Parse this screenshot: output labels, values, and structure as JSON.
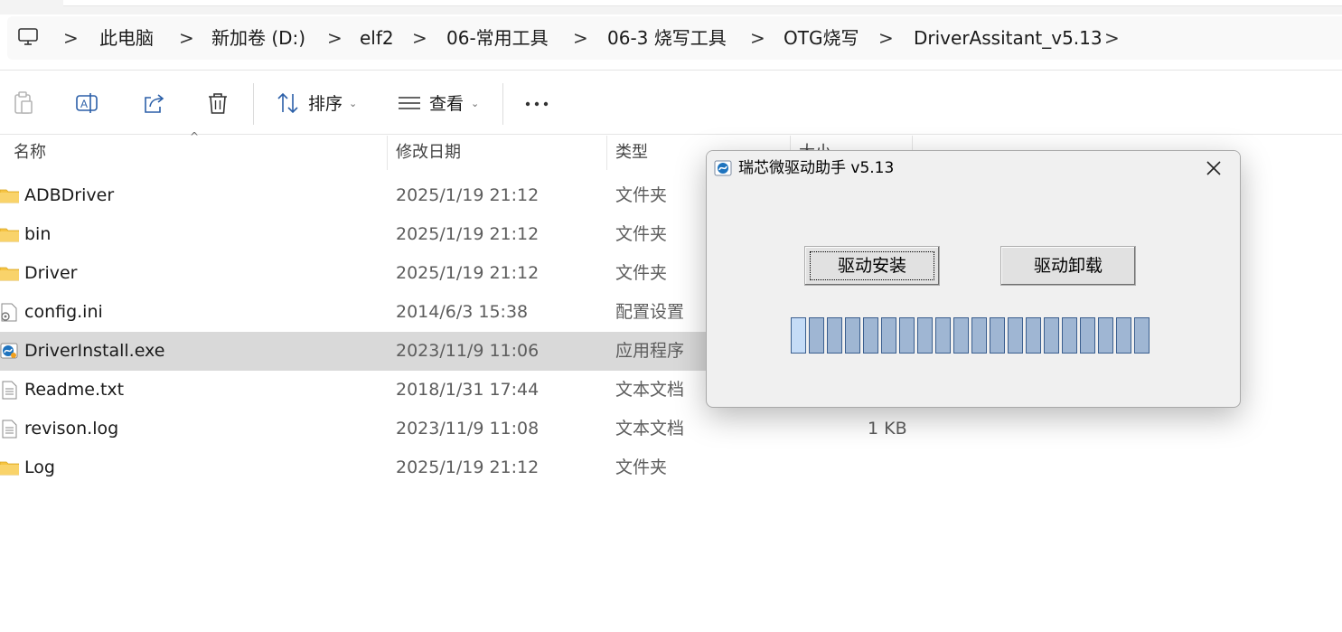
{
  "address_bar": {
    "segments": [
      "此电脑",
      "新加卷 (D:)",
      "elf2",
      "06-常用工具",
      "06-3 烧写工具",
      "OTG烧写",
      "DriverAssitant_v5.13"
    ],
    "separator": ">"
  },
  "toolbar": {
    "sort_label": "排序",
    "view_label": "查看"
  },
  "columns": {
    "name": "名称",
    "date": "修改日期",
    "type": "类型",
    "size": "大小"
  },
  "files": [
    {
      "name": "ADBDriver",
      "date": "2025/1/19 21:12",
      "type": "文件夹",
      "size": "",
      "icon": "folder-icon"
    },
    {
      "name": "bin",
      "date": "2025/1/19 21:12",
      "type": "文件夹",
      "size": "",
      "icon": "folder-icon"
    },
    {
      "name": "Driver",
      "date": "2025/1/19 21:12",
      "type": "文件夹",
      "size": "",
      "icon": "folder-icon"
    },
    {
      "name": "config.ini",
      "date": "2014/6/3 15:38",
      "type": "配置设置",
      "size": "",
      "icon": "config-file-icon"
    },
    {
      "name": "DriverInstall.exe",
      "date": "2023/11/9 11:06",
      "type": "应用程序",
      "size": "",
      "icon": "app-icon",
      "selected": true
    },
    {
      "name": "Readme.txt",
      "date": "2018/1/31 17:44",
      "type": "文本文档",
      "size": "",
      "icon": "text-file-icon"
    },
    {
      "name": "revison.log",
      "date": "2023/11/9 11:08",
      "type": "文本文档",
      "size": "1 KB",
      "icon": "text-file-icon"
    },
    {
      "name": "Log",
      "date": "2025/1/19 21:12",
      "type": "文件夹",
      "size": "",
      "icon": "folder-icon"
    }
  ],
  "dialog": {
    "title": "瑞芯微驱动助手 v5.13",
    "install_label": "驱动安装",
    "uninstall_label": "驱动卸载",
    "progress_blocks": 20
  },
  "colors": {
    "folder": "#f6c443",
    "selection": "#d9d9d9",
    "progress_fill": "#9fb6d3",
    "progress_border": "#3b5f8f"
  }
}
